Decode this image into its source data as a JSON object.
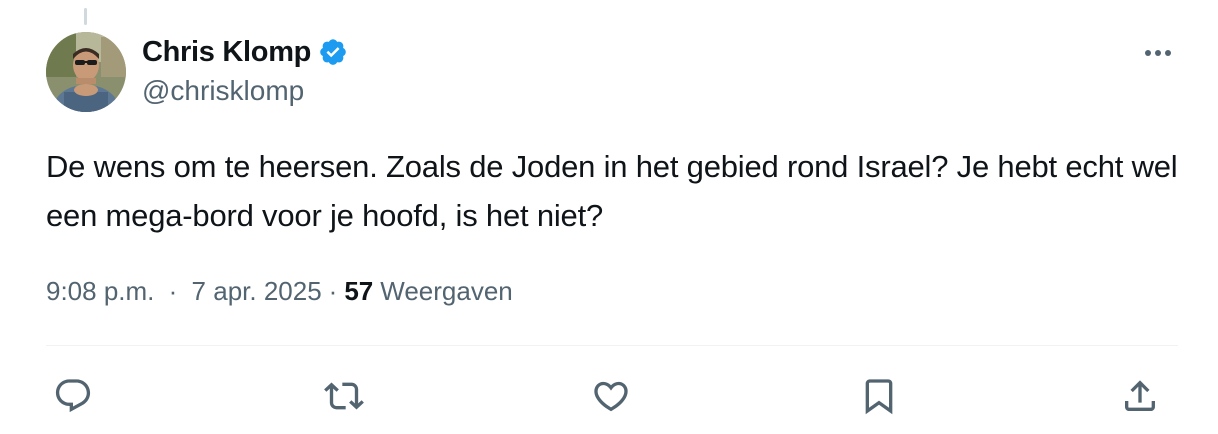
{
  "author": {
    "display_name": "Chris Klomp",
    "handle": "@chrisklomp",
    "verified_badge_icon": "verified-badge-icon",
    "verified_color": "#1d9bf0"
  },
  "tweet": {
    "text": "De wens om te heersen. Zoals de Joden in het gebied rond Israel? Je hebt echt wel een mega-bord voor je hoofd, is het niet?",
    "time": "9:08 p.m.",
    "separator": "·",
    "date": "7 apr. 2025",
    "views_count": "57",
    "views_label": "Weergaven"
  },
  "actions": [
    {
      "name": "reply",
      "icon": "reply-icon"
    },
    {
      "name": "repost",
      "icon": "repost-icon"
    },
    {
      "name": "like",
      "icon": "heart-icon"
    },
    {
      "name": "bookmark",
      "icon": "bookmark-icon"
    },
    {
      "name": "share",
      "icon": "share-icon"
    }
  ],
  "more_menu_icon": "more-dots-icon",
  "colors": {
    "text_primary": "#0f1419",
    "text_secondary": "#536471",
    "divider": "#eff3f4"
  }
}
